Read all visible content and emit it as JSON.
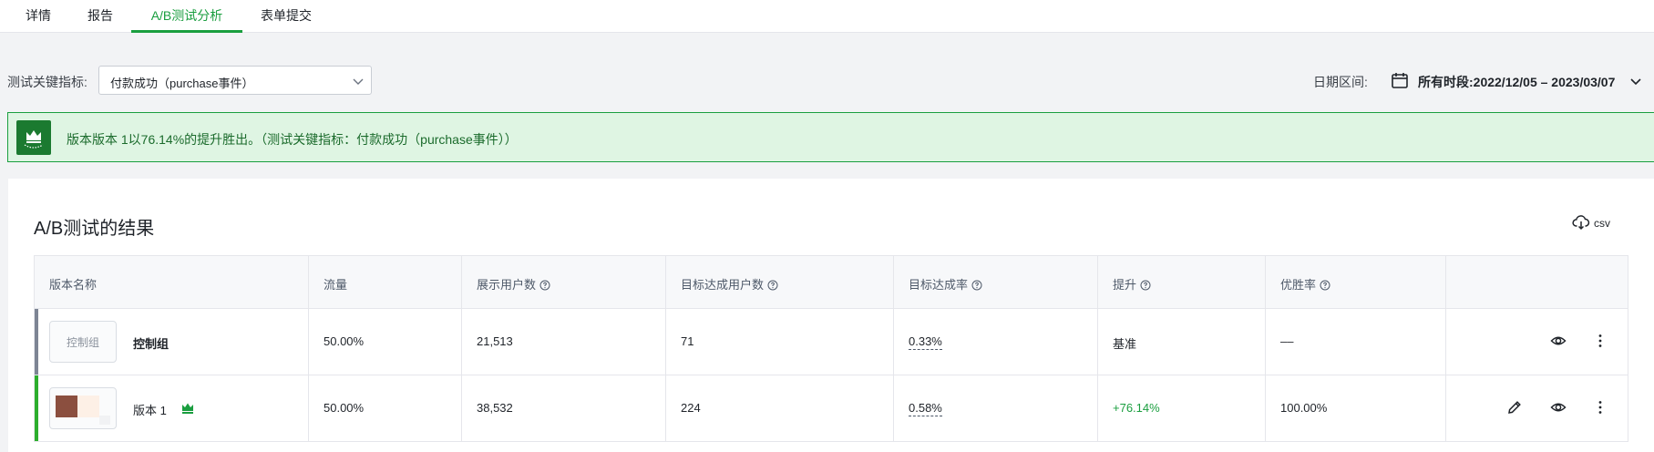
{
  "tabs": [
    {
      "label": "详情"
    },
    {
      "label": "报告"
    },
    {
      "label": "A/B测试分析"
    },
    {
      "label": "表单提交"
    }
  ],
  "filters": {
    "metric_label": "测试关键指标:",
    "metric_value": "付款成功（purchase事件）",
    "date_label": "日期区间:",
    "date_value": "所有时段:2022/12/05 – 2023/03/07"
  },
  "banner": {
    "text": "版本版本 1以76.14%的提升胜出。（测试关键指标：付款成功（purchase事件））"
  },
  "results": {
    "title": "A/B测试的结果",
    "csv_label": "csv",
    "columns": [
      "版本名称",
      "流量",
      "展示用户数",
      "目标达成用户数",
      "目标达成率",
      "提升",
      "优胜率"
    ],
    "rows": [
      {
        "thumb_label": "控制组",
        "name": "控制组",
        "traffic": "50.00%",
        "exposed_users": "21,513",
        "goal_users": "71",
        "goal_rate": "0.33%",
        "lift": "基准",
        "win_rate": "––",
        "bar_color": "#7d8594"
      },
      {
        "thumb_label": "",
        "name": "版本 1",
        "traffic": "50.00%",
        "exposed_users": "38,532",
        "goal_users": "224",
        "goal_rate": "0.58%",
        "lift": "+76.14%",
        "win_rate": "100.00%",
        "bar_color": "#2cae2c"
      }
    ]
  },
  "colors": {
    "accent_green": "#1a9e3f",
    "banner_bg": "#dff5e3",
    "crown_box": "#1b7a30"
  },
  "icons": [
    "chevron-down-icon",
    "calendar-icon",
    "crown-icon",
    "cloud-download-icon",
    "help-icon",
    "edit-icon",
    "eye-icon",
    "more-vertical-icon"
  ]
}
